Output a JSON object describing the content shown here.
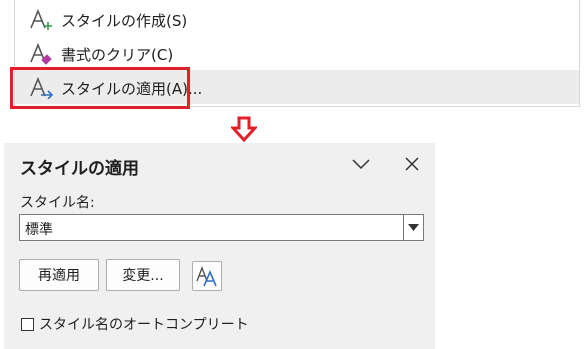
{
  "menu": {
    "items": [
      {
        "label": "スタイルの作成(S)",
        "icon": "create-style-icon"
      },
      {
        "label": "書式のクリア(C)",
        "icon": "clear-formatting-icon"
      },
      {
        "label": "スタイルの適用(A)...",
        "icon": "apply-styles-icon"
      }
    ]
  },
  "pane": {
    "title": "スタイルの適用",
    "style_name_label": "スタイル名:",
    "style_name_value": "標準",
    "reapply_label": "再適用",
    "modify_label": "変更...",
    "autocomplete_label": "スタイル名のオートコンプリート",
    "autocomplete_checked": false
  },
  "colors": {
    "highlight": "#e3202a",
    "arrow": "#e3202a",
    "create_icon_accent": "#2e9e47",
    "clear_icon_accent": "#b03aa0",
    "apply_icon_accent": "#2f6fc7",
    "pane_bg": "#f0f0f0"
  }
}
